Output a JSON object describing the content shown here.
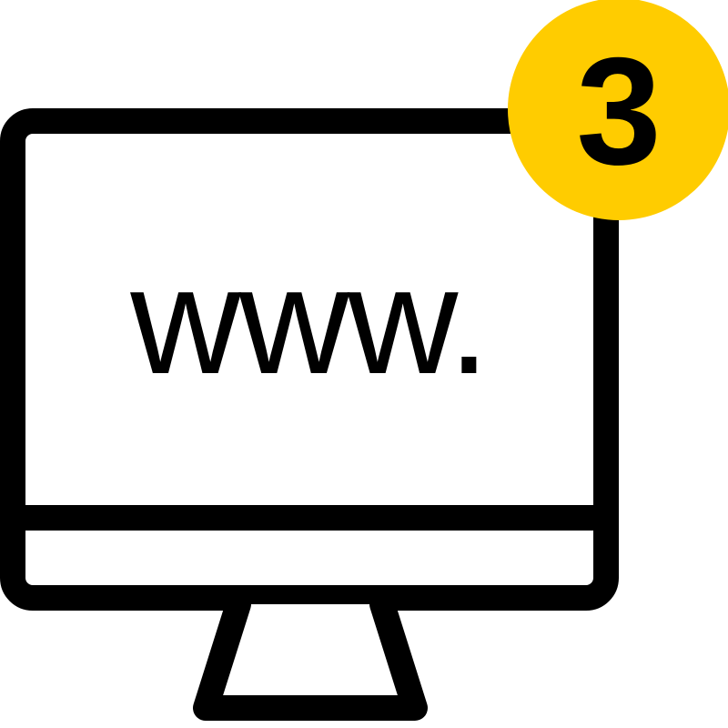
{
  "monitor": {
    "screen_text": "www."
  },
  "badge": {
    "count": "3"
  },
  "colors": {
    "stroke": "#000000",
    "background": "#ffffff",
    "badge_fill": "#FFCC00"
  },
  "icons": {
    "monitor": "desktop-monitor-icon",
    "badge": "notification-badge-icon"
  }
}
